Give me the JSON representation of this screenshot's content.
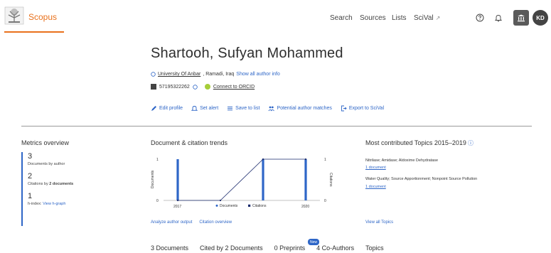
{
  "header": {
    "brand": "Scopus",
    "nav": {
      "search": "Search",
      "sources": "Sources",
      "lists": "Lists",
      "scival": "SciVal",
      "scival_arrow": "↗"
    },
    "avatar_initials": "KD",
    "accent": "#e9711c"
  },
  "author": {
    "name": "Shartooh, Sufyan Mohammed",
    "affiliation": "University Of Anbar",
    "location": ", Ramadi, Iraq",
    "show_info": "Show all author info",
    "author_id": "57195322262",
    "orcid": "Connect to ORCID"
  },
  "actions": {
    "edit": "Edit profile",
    "alert": "Set alert",
    "save": "Save to list",
    "matches": "Potential author matches",
    "export": "Export to SciVal"
  },
  "metrics": {
    "title": "Metrics overview",
    "documents_value": "3",
    "documents_label": "Documents by author",
    "citations_value": "2",
    "citations_label_prefix": "Citations by",
    "citations_label_bold": "2 documents",
    "hindex_value": "1",
    "hindex_label": "h-index:",
    "hindex_link": "View h-graph"
  },
  "trends": {
    "title": "Document & citation trends",
    "analyze_link": "Analyze author output",
    "citation_link": "Citation overview"
  },
  "chart_data": {
    "type": "bar",
    "x": [
      2017,
      2018,
      2019,
      2020
    ],
    "x_tick_labels": [
      "2017",
      "2020"
    ],
    "series": [
      {
        "name": "Documents",
        "type": "bar",
        "values": [
          1,
          0,
          1,
          1
        ],
        "color": "#2e66c7"
      },
      {
        "name": "Citations",
        "type": "line",
        "values": [
          0,
          0,
          1,
          1
        ],
        "color": "#1a2a6c"
      }
    ],
    "ylabel_left": "Documents",
    "ylabel_right": "Citations",
    "y_left_ticks": [
      "0",
      "1"
    ],
    "y_right_ticks": [
      "0",
      "1"
    ],
    "ylim": [
      0,
      1
    ],
    "legend_position": "bottom-center"
  },
  "topics": {
    "title": "Most contributed Topics 2015–2019",
    "info_icon": "ⓘ",
    "items": [
      {
        "name": "Nitrilase; Amidase; Aldoxime Dehydratase",
        "count": "1 document"
      },
      {
        "name": "Water Quality; Source Apportionment; Nonpoint Source Pollution",
        "count": "1 document"
      }
    ],
    "view_all": "View all Topics"
  },
  "tabs": {
    "documents": "3 Documents",
    "cited_by": "Cited by 2 Documents",
    "preprints": "0 Preprints",
    "coauthors": "4 Co-Authors",
    "topics": "Topics",
    "new_badge": "New"
  }
}
